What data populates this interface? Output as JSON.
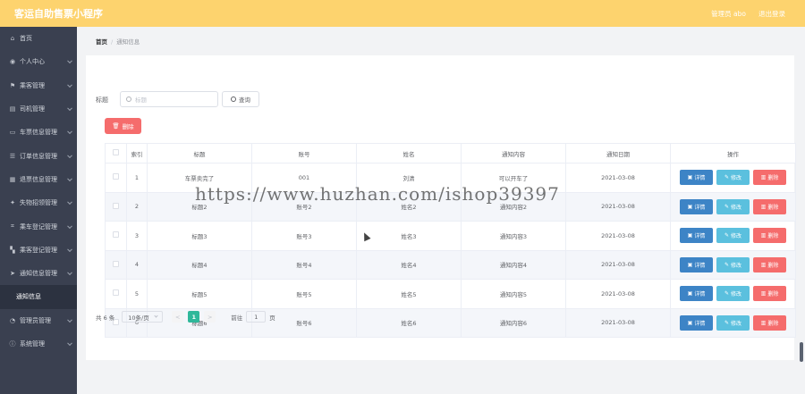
{
  "header": {
    "title": "客运自助售票小程序",
    "user": "管理员 abo",
    "logout": "退出登录"
  },
  "sidebar": {
    "items": [
      {
        "label": "首页",
        "icon": "home-icon"
      },
      {
        "label": "个人中心",
        "icon": "user-icon"
      },
      {
        "label": "乘客管理",
        "icon": "flag-icon"
      },
      {
        "label": "司机管理",
        "icon": "doc-icon"
      },
      {
        "label": "车票信息管理",
        "icon": "chat-icon"
      },
      {
        "label": "订单信息管理",
        "icon": "list-icon"
      },
      {
        "label": "退票信息管理",
        "icon": "calendar-icon"
      },
      {
        "label": "失物招领管理",
        "icon": "tool-icon"
      },
      {
        "label": "乘车登记管理",
        "icon": "frame-icon"
      },
      {
        "label": "乘客登记管理",
        "icon": "grid-icon"
      },
      {
        "label": "通知信息管理",
        "icon": "send-icon"
      },
      {
        "label": "通知信息",
        "icon": ""
      },
      {
        "label": "管理员管理",
        "icon": "clock-icon"
      },
      {
        "label": "系统管理",
        "icon": "info-icon"
      }
    ]
  },
  "breadcrumb": {
    "home": "首页",
    "sep": "/",
    "current": "通知信息"
  },
  "search": {
    "label": "标题",
    "placeholder": "标题",
    "button": "查询"
  },
  "delete_button": "删除",
  "table": {
    "headers": [
      "",
      "索引",
      "标题",
      "账号",
      "姓名",
      "通知内容",
      "通知日期",
      "操作"
    ],
    "rows": [
      {
        "index": "1",
        "title": "车票卖完了",
        "account": "001",
        "name": "刘清",
        "content": "可以开车了",
        "date": "2021-03-08"
      },
      {
        "index": "2",
        "title": "标题2",
        "account": "账号2",
        "name": "姓名2",
        "content": "通知内容2",
        "date": "2021-03-08"
      },
      {
        "index": "3",
        "title": "标题3",
        "account": "账号3",
        "name": "姓名3",
        "content": "通知内容3",
        "date": "2021-03-08"
      },
      {
        "index": "4",
        "title": "标题4",
        "account": "账号4",
        "name": "姓名4",
        "content": "通知内容4",
        "date": "2021-03-08"
      },
      {
        "index": "5",
        "title": "标题5",
        "account": "账号5",
        "name": "姓名5",
        "content": "通知内容5",
        "date": "2021-03-08"
      },
      {
        "index": "6",
        "title": "标题6",
        "account": "账号6",
        "name": "姓名6",
        "content": "通知内容6",
        "date": "2021-03-08"
      }
    ],
    "actions": {
      "detail": "详情",
      "edit": "修改",
      "delete": "删除"
    }
  },
  "pagination": {
    "total": "共 6 条",
    "page_size": "10条/页",
    "prev": "<",
    "current": "1",
    "next": ">",
    "goto_label": "前往",
    "goto_value": "1",
    "goto_suffix": "页"
  },
  "watermark": "https://www.huzhan.com/ishop39397",
  "colors": {
    "header": "#fdd36e",
    "sidebar": "#3a4050",
    "detail": "#3d84c6",
    "edit": "#5bc0de",
    "delete": "#f56c6c",
    "page_active": "#2fb89a"
  }
}
